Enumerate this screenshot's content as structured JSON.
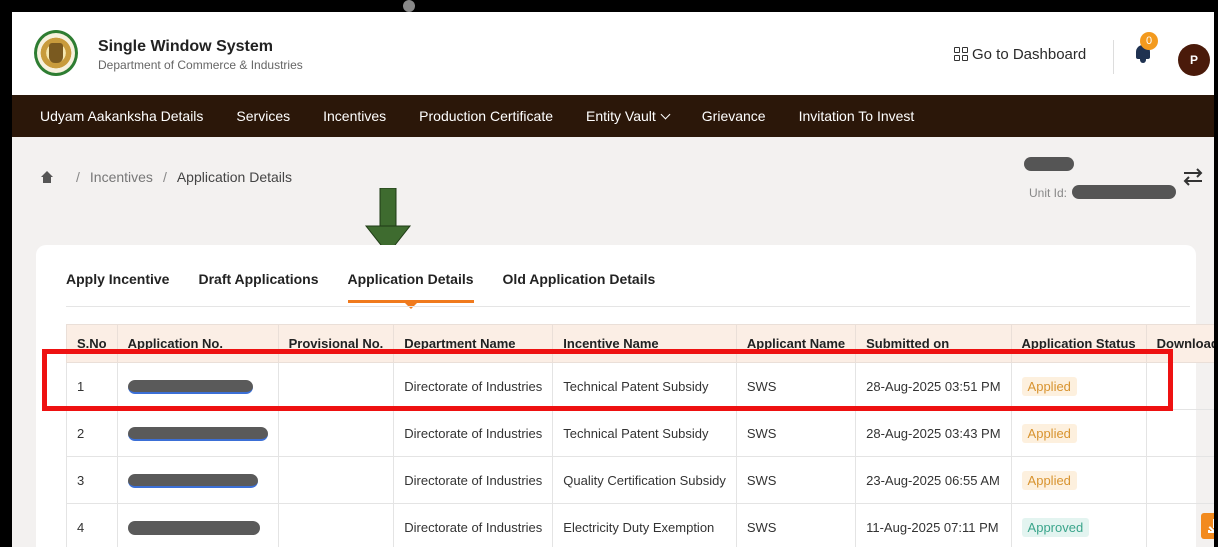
{
  "header": {
    "title": "Single Window System",
    "subtitle": "Department of Commerce & Industries",
    "dashboard_link": "Go to Dashboard",
    "notification_count": "0",
    "avatar_initial": "P"
  },
  "nav": {
    "items": [
      "Udyam Aakanksha Details",
      "Services",
      "Incentives",
      "Production Certificate",
      "Entity Vault",
      "Grievance",
      "Invitation To Invest"
    ]
  },
  "breadcrumb": {
    "sep": "/",
    "items": [
      "Incentives",
      "Application Details"
    ]
  },
  "unit": {
    "label": "Unit Id:"
  },
  "tabs": [
    {
      "label": "Apply Incentive"
    },
    {
      "label": "Draft Applications"
    },
    {
      "label": "Application Details",
      "active": true
    },
    {
      "label": "Old Application Details"
    }
  ],
  "table": {
    "columns": [
      "S.No",
      "Application No.",
      "Provisional No.",
      "Department Name",
      "Incentive Name",
      "Applicant Name",
      "Submitted on",
      "Application Status",
      "Download Certificate"
    ],
    "rows": [
      {
        "sno": "1",
        "department": "Directorate of Industries",
        "incentive": "Technical Patent Subsidy",
        "applicant": "SWS",
        "submitted": "28-Aug-2025 03:51 PM",
        "status": "Applied"
      },
      {
        "sno": "2",
        "department": "Directorate of Industries",
        "incentive": "Technical Patent Subsidy",
        "applicant": "SWS",
        "submitted": "28-Aug-2025 03:43 PM",
        "status": "Applied"
      },
      {
        "sno": "3",
        "department": "Directorate of Industries",
        "incentive": "Quality Certification Subsidy",
        "applicant": "SWS",
        "submitted": "23-Aug-2025 06:55 AM",
        "status": "Applied"
      },
      {
        "sno": "4",
        "department": "Directorate of Industries",
        "incentive": "Electricity Duty Exemption",
        "applicant": "SWS",
        "submitted": "11-Aug-2025 07:11 PM",
        "status": "Approved"
      }
    ]
  },
  "colors": {
    "nav_bg": "#2b1709",
    "accent_orange": "#f07a1d",
    "highlight_red": "#ee1111",
    "annotation_arrow": "#3e6b2f"
  },
  "icons": [
    "grid-icon",
    "bell-icon",
    "home-icon",
    "chevron-down-icon",
    "switch-arrows-icon",
    "download-icon"
  ]
}
